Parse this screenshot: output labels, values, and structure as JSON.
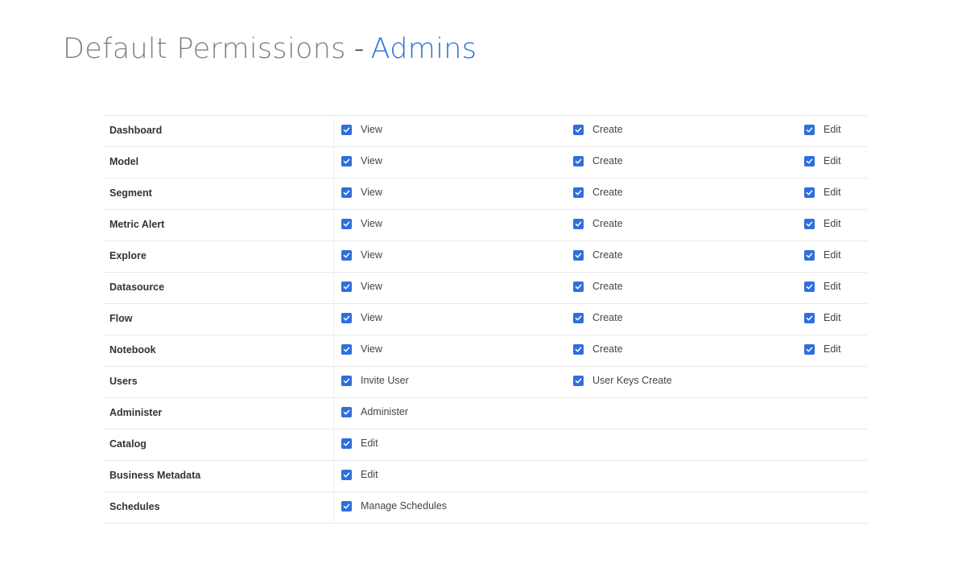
{
  "page": {
    "title": "Default Permissions",
    "separator": "-",
    "title_accent": "Admins"
  },
  "permissions": [
    {
      "label": "Dashboard",
      "items": [
        {
          "label": "View",
          "checked": true
        },
        {
          "label": "Create",
          "checked": true
        },
        {
          "label": "Edit",
          "checked": true
        }
      ]
    },
    {
      "label": "Model",
      "items": [
        {
          "label": "View",
          "checked": true
        },
        {
          "label": "Create",
          "checked": true
        },
        {
          "label": "Edit",
          "checked": true
        }
      ]
    },
    {
      "label": "Segment",
      "items": [
        {
          "label": "View",
          "checked": true
        },
        {
          "label": "Create",
          "checked": true
        },
        {
          "label": "Edit",
          "checked": true
        }
      ]
    },
    {
      "label": "Metric Alert",
      "items": [
        {
          "label": "View",
          "checked": true
        },
        {
          "label": "Create",
          "checked": true
        },
        {
          "label": "Edit",
          "checked": true
        }
      ]
    },
    {
      "label": "Explore",
      "items": [
        {
          "label": "View",
          "checked": true
        },
        {
          "label": "Create",
          "checked": true
        },
        {
          "label": "Edit",
          "checked": true
        }
      ]
    },
    {
      "label": "Datasource",
      "items": [
        {
          "label": "View",
          "checked": true
        },
        {
          "label": "Create",
          "checked": true
        },
        {
          "label": "Edit",
          "checked": true
        }
      ]
    },
    {
      "label": "Flow",
      "items": [
        {
          "label": "View",
          "checked": true
        },
        {
          "label": "Create",
          "checked": true
        },
        {
          "label": "Edit",
          "checked": true
        }
      ]
    },
    {
      "label": "Notebook",
      "items": [
        {
          "label": "View",
          "checked": true
        },
        {
          "label": "Create",
          "checked": true
        },
        {
          "label": "Edit",
          "checked": true
        }
      ]
    },
    {
      "label": "Users",
      "items": [
        {
          "label": "Invite User",
          "checked": true
        },
        {
          "label": "User Keys Create",
          "checked": true
        }
      ]
    },
    {
      "label": "Administer",
      "items": [
        {
          "label": "Administer",
          "checked": true
        }
      ]
    },
    {
      "label": "Catalog",
      "items": [
        {
          "label": "Edit",
          "checked": true
        }
      ]
    },
    {
      "label": "Business Metadata",
      "items": [
        {
          "label": "Edit",
          "checked": true
        }
      ]
    },
    {
      "label": "Schedules",
      "items": [
        {
          "label": "Manage Schedules",
          "checked": true
        }
      ]
    }
  ],
  "colors": {
    "accent": "#2f6fdc",
    "title_gray": "#808080",
    "divider": "#e8e8e8"
  }
}
